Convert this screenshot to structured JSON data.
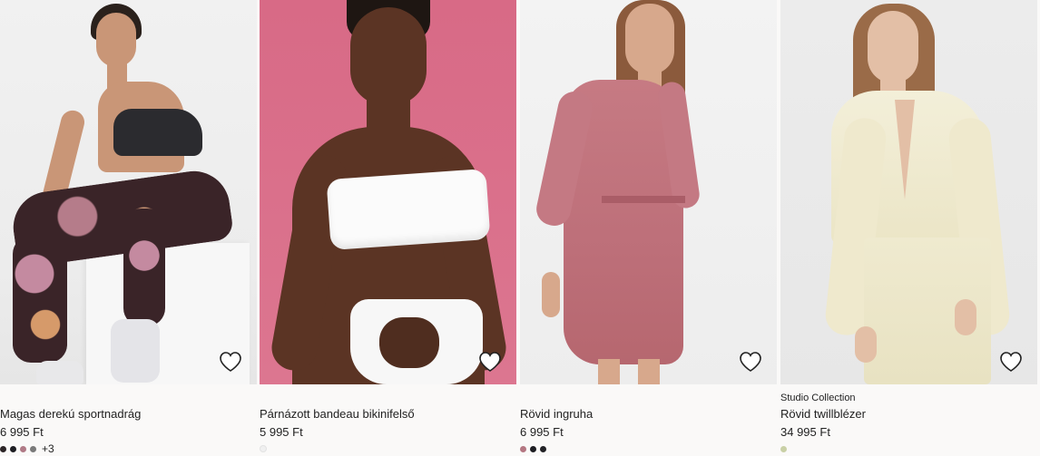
{
  "products": [
    {
      "brand": "",
      "name": "Magas derekú sportnadrág",
      "price": "6 995 Ft",
      "swatches": [
        "#2b2426",
        "#1d1d22",
        "#b07a86",
        "#7a7a7a"
      ],
      "more_colors": "+3",
      "image_description": "woman in sports bra and floral leggings sitting on white box",
      "favorite_icon": "heart-outline-icon"
    },
    {
      "brand": "",
      "name": "Párnázott bandeau bikinifelső",
      "price": "5 995 Ft",
      "swatches": [
        "#f0f0f0"
      ],
      "more_colors": "",
      "image_description": "woman in white ruffled bandeau bikini on pink background",
      "favorite_icon": "heart-outline-icon"
    },
    {
      "brand": "",
      "name": "Rövid ingruha",
      "price": "6 995 Ft",
      "swatches": [
        "#b47782",
        "#1d1d22",
        "#222226"
      ],
      "more_colors": "",
      "image_description": "woman in dusty pink belted shirt dress",
      "favorite_icon": "heart-outline-icon"
    },
    {
      "brand": "Studio Collection",
      "name": "Rövid twillblézer",
      "price": "34 995 Ft",
      "swatches": [
        "#c9d0a6"
      ],
      "more_colors": "",
      "image_description": "woman in cream cropped twill blazer and trousers",
      "favorite_icon": "heart-outline-icon"
    }
  ]
}
